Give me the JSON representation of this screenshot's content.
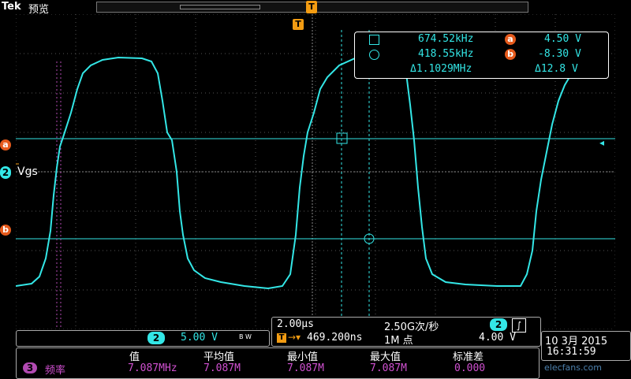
{
  "header": {
    "brand": "Tek",
    "mode": "预览",
    "trigger_marker": "T"
  },
  "channel": {
    "number": "2",
    "label": "Vgs",
    "scale": "5.00 V",
    "bw": "B W"
  },
  "cursors": {
    "a_label": "a",
    "b_label": "b",
    "row1": {
      "freq": "674.52kHz",
      "tag": "a",
      "volt": "4.50 V"
    },
    "row2": {
      "freq": "418.55kHz",
      "tag": "b",
      "volt": "-8.30 V"
    },
    "row3": {
      "delta_freq": "Δ1.1029MHz",
      "delta_volt": "Δ12.8 V"
    }
  },
  "horizontal": {
    "timebase": "2.00µs",
    "sample_rate": "2.50G次/秒",
    "trigger_pos": "469.200ns",
    "record_length": "1M 点"
  },
  "trigger": {
    "source": "2",
    "slope": "∫",
    "level": "4.00 V"
  },
  "datetime": {
    "date": "10 3月 2015",
    "time": "16:31:59"
  },
  "measurement": {
    "channel": "3",
    "name": "频率",
    "headers": [
      "值",
      "平均值",
      "最小值",
      "最大值",
      "标准差"
    ],
    "values": [
      "7.087MHz",
      "7.087M",
      "7.087M",
      "7.087M",
      "0.000"
    ]
  },
  "watermark": "elecfans.com",
  "colors": {
    "trace": "#33e6e6",
    "cursor_tag": "#e55a1c",
    "trigger": "#f39c12",
    "math": "#b24ab2"
  }
}
